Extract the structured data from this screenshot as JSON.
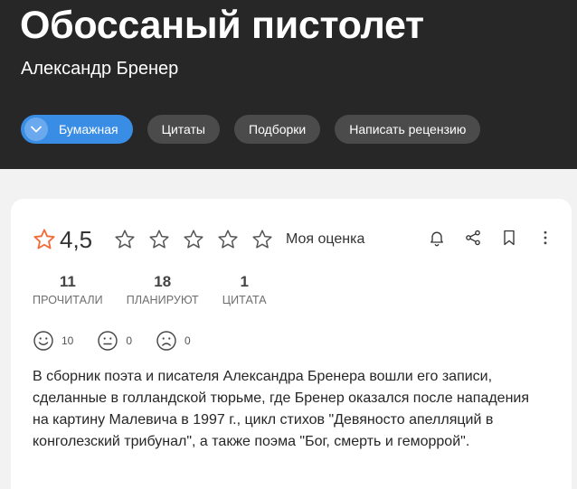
{
  "book": {
    "title": "Обоссаный пистолет",
    "author": "Александр Бренер"
  },
  "chips": [
    {
      "label": "Бумажная",
      "icon": "chevron-down-icon",
      "active": true
    },
    {
      "label": "Цитаты"
    },
    {
      "label": "Подборки"
    },
    {
      "label": "Написать рецензию"
    }
  ],
  "rating": {
    "value": "4,5",
    "my_rating_label": "Моя оценка",
    "max_stars": 5
  },
  "stats": [
    {
      "value": "11",
      "label": "ПРОЧИТАЛИ"
    },
    {
      "value": "18",
      "label": "ПЛАНИРУЮТ"
    },
    {
      "value": "1",
      "label": "ЦИТАТА"
    }
  ],
  "reactions": [
    {
      "icon": "smile-icon",
      "count": "10"
    },
    {
      "icon": "neutral-face-icon",
      "count": "0"
    },
    {
      "icon": "sad-face-icon",
      "count": "0"
    }
  ],
  "description": "В сборник поэта и писателя Александра Бренера вошли его записи, сделанные в голландской тюрьме, где Бренер оказался после нападения на картину Малевича в 1997 г., цикл стихов \"Девяносто апелляций в конголезский трибунал\", а также поэма \"Бог, смерть и геморрой\".",
  "colors": {
    "hero_bg": "#272727",
    "accent": "#3a8de5",
    "chip_bg": "#4b4b4b",
    "rating_star": "#f26b3a"
  }
}
